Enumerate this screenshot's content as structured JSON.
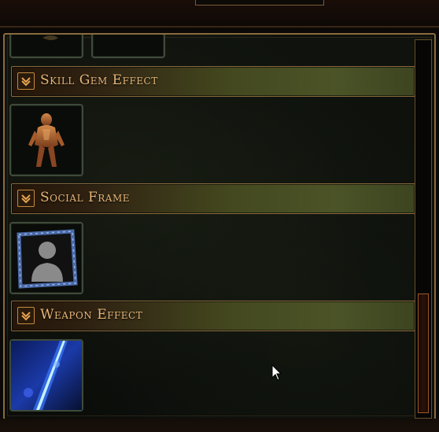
{
  "sections": [
    {
      "label": "Skill Gem Effect",
      "icon": "chevron-down-icon"
    },
    {
      "label": "Social Frame",
      "icon": "chevron-down-icon"
    },
    {
      "label": "Weapon Effect",
      "icon": "chevron-down-icon"
    }
  ],
  "items": [
    {
      "name": "armored-character-item",
      "depicts": "armored-character"
    },
    {
      "name": "silhouette-portrait-item",
      "depicts": "portrait-silhouette"
    },
    {
      "name": "blue-weapon-effect-item",
      "depicts": "blue-energy-blade"
    }
  ],
  "colors": {
    "header_text": "#e6b779",
    "frame_border": "#8a6a3e",
    "header_green": "#4b5327"
  }
}
